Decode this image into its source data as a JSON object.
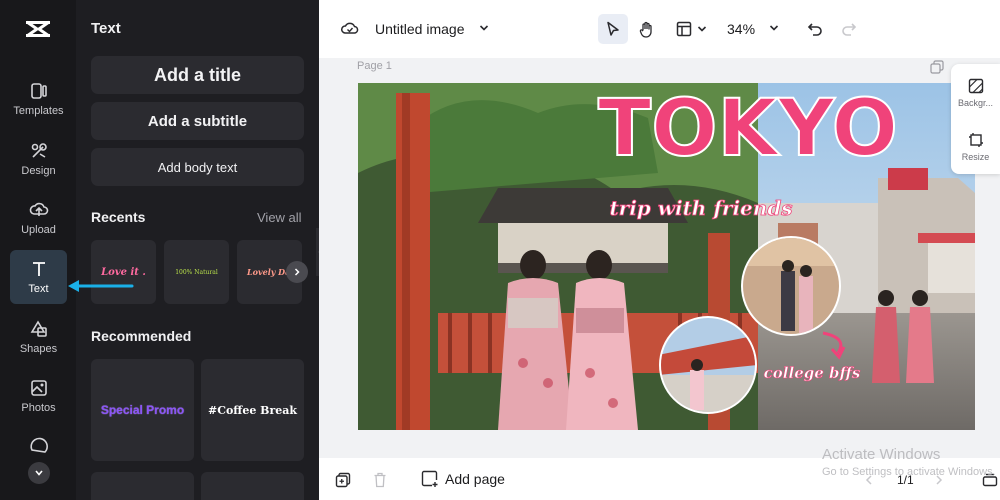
{
  "rail": {
    "items": [
      {
        "label": "Templates",
        "icon": "templates-icon"
      },
      {
        "label": "Design",
        "icon": "design-icon"
      },
      {
        "label": "Upload",
        "icon": "upload-icon"
      },
      {
        "label": "Text",
        "icon": "text-icon",
        "active": true
      },
      {
        "label": "Shapes",
        "icon": "shapes-icon"
      },
      {
        "label": "Photos",
        "icon": "photos-icon"
      }
    ]
  },
  "panel": {
    "title": "Text",
    "add_title": "Add a title",
    "add_subtitle": "Add a subtitle",
    "add_body": "Add body text",
    "recents_heading": "Recents",
    "view_all": "View all",
    "recents": [
      "Love it .",
      "100% Natural",
      "Lovely Day"
    ],
    "recommended_heading": "Recommended",
    "recommended": [
      "Special Promo",
      "#Coffee Break"
    ]
  },
  "toolbar": {
    "doc_title": "Untitled image",
    "zoom": "34%"
  },
  "canvas": {
    "page_label": "Page 1",
    "headline": "TOKYO",
    "subheadline": "trip with friends",
    "caption": "college bffs"
  },
  "side_tools": {
    "background_label": "Backgr...",
    "resize_label": "Resize"
  },
  "bottombar": {
    "add_page": "Add page",
    "page_count": "1/1"
  },
  "watermark": {
    "line1": "Activate Windows",
    "line2": "Go to Settings to activate Windows."
  },
  "colors": {
    "accent_pink": "#f0437a",
    "rail_bg": "#18181b",
    "panel_bg": "#1e1e22",
    "arrow": "#1ab0e8"
  }
}
